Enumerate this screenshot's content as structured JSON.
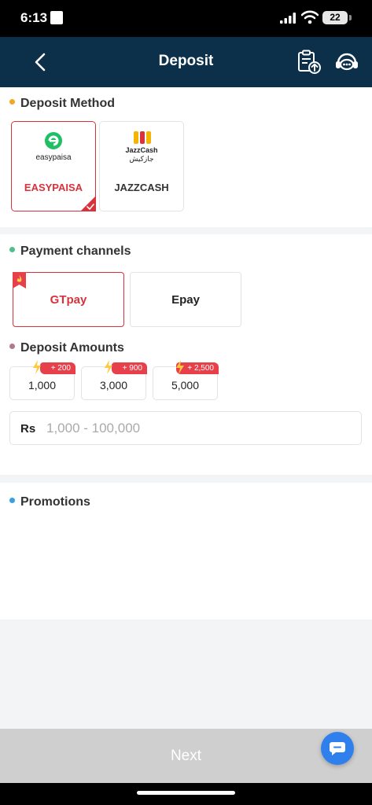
{
  "status_bar": {
    "time": "6:13",
    "battery": "22"
  },
  "header": {
    "title": "Deposit"
  },
  "deposit_method": {
    "title": "Deposit Method",
    "dot_color": "#f5a623",
    "methods": [
      {
        "logo_text": "easypaisa",
        "label": "EASYPAISA",
        "selected": true
      },
      {
        "logo_text": "JazzCash",
        "logo_text_urdu": "جازکیش",
        "label": "JAZZCASH",
        "selected": false
      }
    ]
  },
  "payment_channels": {
    "title": "Payment channels",
    "dot_color": "#4fc08d",
    "channels": [
      {
        "label": "GTpay",
        "selected": true,
        "hot": true
      },
      {
        "label": "Epay",
        "selected": false,
        "hot": false
      }
    ]
  },
  "deposit_amounts": {
    "title": "Deposit Amounts",
    "dot_color": "#b07a8c",
    "options": [
      {
        "value": "1,000",
        "bonus": "+ 200"
      },
      {
        "value": "3,000",
        "bonus": "+ 900"
      },
      {
        "value": "5,000",
        "bonus": "+ 2,500"
      }
    ],
    "input": {
      "prefix": "Rs",
      "placeholder": "1,000 - 100,000",
      "value": ""
    }
  },
  "promotions": {
    "title": "Promotions",
    "dot_color": "#3aa0e0"
  },
  "footer": {
    "next_label": "Next"
  },
  "colors": {
    "header_bg": "#0c2f4a",
    "accent_red": "#d8323c",
    "chat_blue": "#2f80ed"
  },
  "icons": [
    "back-arrow-icon",
    "deposit-record-icon",
    "customer-service-icon",
    "check-icon",
    "hot-flame-icon",
    "bonus-coin-icon",
    "chat-bubble-icon"
  ]
}
